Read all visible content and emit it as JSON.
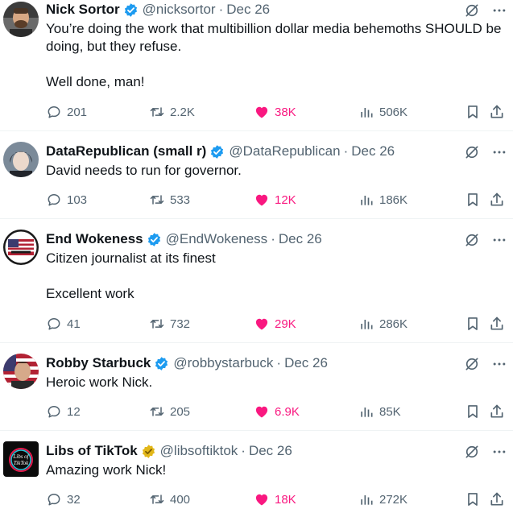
{
  "colors": {
    "accent_blue": "#1d9bf0",
    "like_pink": "#f91880",
    "secondary_text": "#536471",
    "gold_badge": "#e2b719"
  },
  "tweets": [
    {
      "name": "Nick Sortor",
      "handle": "@nicksortor",
      "date": "Dec 26",
      "badge": "verified-blue",
      "text_lines": [
        "You’re doing the work that multibillion dollar media behemoths SHOULD be doing, but they refuse.",
        "Well done, man!"
      ],
      "replies": "201",
      "retweets": "2.2K",
      "likes": "38K",
      "views": "506K"
    },
    {
      "name": "DataRepublican (small r)",
      "handle": "@DataRepublican",
      "date": "Dec 26",
      "badge": "verified-blue",
      "text_lines": [
        "David needs to run for governor."
      ],
      "replies": "103",
      "retweets": "533",
      "likes": "12K",
      "views": "186K"
    },
    {
      "name": "End Wokeness",
      "handle": "@EndWokeness",
      "date": "Dec 26",
      "badge": "verified-blue",
      "text_lines": [
        "Citizen journalist at its finest",
        "Excellent work"
      ],
      "replies": "41",
      "retweets": "732",
      "likes": "29K",
      "views": "286K"
    },
    {
      "name": "Robby Starbuck",
      "handle": "@robbystarbuck",
      "date": "Dec 26",
      "badge": "verified-blue",
      "text_lines": [
        "Heroic work Nick."
      ],
      "replies": "12",
      "retweets": "205",
      "likes": "6.9K",
      "views": "85K"
    },
    {
      "name": "Libs of TikTok",
      "handle": "@libsoftiktok",
      "date": "Dec 26",
      "badge": "verified-gold",
      "avatar_text": "Libs of TikTok",
      "text_lines": [
        "Amazing work Nick!"
      ],
      "replies": "32",
      "retweets": "400",
      "likes": "18K",
      "views": "272K"
    }
  ],
  "separator": "·"
}
